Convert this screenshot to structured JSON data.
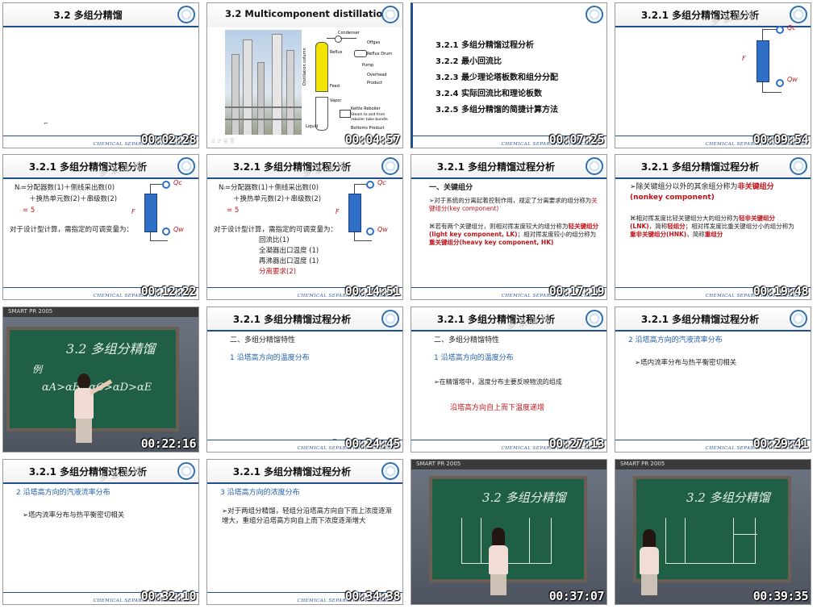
{
  "footer_text": "CHEMICAL SEPARATION PROCESSES",
  "watermark": "多 录 课 程",
  "tiles": [
    {
      "title": "3.2  多组分精馏",
      "time": "00:02:28"
    },
    {
      "title": "3.2  Multicomponent distillation",
      "time": "00:04:57",
      "diagram": {
        "condenser": "Condenser",
        "offgas": "Offgas",
        "reflux_drum": "Reflux Drum",
        "pump": "Pump",
        "overhead": "Overhead Product",
        "reflux": "Reflux",
        "feed": "Feed",
        "vapor": "Vapor",
        "kettle": "Kettle Reboiler",
        "steam": "Steam to and from reboiler tube bundle",
        "liquid": "Liquid",
        "bottoms": "Bottoms Product",
        "column_label": "Distillation column",
        "bottom_caption": "设 计 装 置"
      }
    },
    {
      "title": "",
      "time": "00:07:25",
      "items": [
        "3.2.1 多组分精馏过程分析",
        "3.2.2 最小回流比",
        "3.2.3 最少理论塔板数和组分分配",
        "3.2.4 实际回流比和理论板数",
        "3.2.5 多组分精馏的简捷计算方法"
      ]
    },
    {
      "title": "3.2.1 多组分精馏过程分析",
      "time": "00:09:54",
      "labels": {
        "qc": "Qc",
        "qw": "Qw",
        "f": "F"
      }
    },
    {
      "title": "3.2.1 多组分精馏过程分析",
      "time": "00:12:22",
      "lines": [
        "Nᵢ=分配器数(1)＋侧线采出数(0)",
        "＋换热单元数(2)＋串级数(2)",
        "= 5",
        "对于设计型计算，需指定的可调变量为："
      ],
      "labels": {
        "qc": "Qc",
        "qw": "Qw",
        "f": "F"
      }
    },
    {
      "title": "3.2.1 多组分精馏过程分析",
      "time": "00:14:51",
      "lines": [
        "Nᵢ=分配器数(1)＋侧线采出数(0)",
        "＋换热单元数(2)＋串级数(2)",
        "= 5",
        "对于设计型计算，需指定的可调变量为："
      ],
      "list": [
        "回流比(1)",
        "全凝器出口温度 (1)",
        "再沸器出口温度 (1)",
        "分离要求(2)"
      ],
      "labels": {
        "qc": "Qc",
        "qw": "Qw",
        "f": "F"
      }
    },
    {
      "title": "3.2.1 多组分精馏过程分析",
      "time": "00:17:19",
      "heading": "一、关键组分",
      "p1a": "对于系统的分离起着控制作用，规定了分离要求的组分称为",
      "p1b": "关键组分(key component)",
      "p2a": "若有两个关键组分，则相对挥发度较大的组分称为",
      "p2b": "轻关键组分(light key component, LK)",
      "p2c": "；相对挥发度较小的组分称为",
      "p2d": "重关键组分(heavy key component, HK)"
    },
    {
      "title": "3.2.1 多组分精馏过程分析",
      "time": "00:19:48",
      "p1a": "除关键组分以外的其余组分称为",
      "p1b": "非关键组分(nonkey component)",
      "p2a": "相对挥发度比轻关键组分大的组分称为",
      "p2b": "轻非关键组分(LNK)",
      "p2c": "，简称",
      "p2d": "轻组分",
      "p2e": "；相对挥发度比重关键组分小的组分称为",
      "p2f": "重非关键组分(HNK)",
      "p2g": "，简称",
      "p2h": "重组分"
    },
    {
      "bar": "SMART  PR 2005",
      "time": "00:22:16",
      "chalk1": "3.2 多组分精馏",
      "chalk2": "例",
      "chalk3": "αA>αB>αC>αD>αE"
    },
    {
      "title": "3.2.1 多组分精馏过程分析",
      "time": "00:24:45",
      "heading": "二、多组分精馏特性",
      "sub": "1  沿塔高方向的温度分布"
    },
    {
      "title": "3.2.1 多组分精馏过程分析",
      "time": "00:27:13",
      "heading": "二、多组分精馏特性",
      "sub": "1  沿塔高方向的温度分布",
      "bullet": "在精馏塔中，温度分布主要反映物流的组成",
      "emph": "沿塔高方向自上而下温度递增"
    },
    {
      "title": "3.2.1 多组分精馏过程分析",
      "time": "00:29:41",
      "sub": "2  沿塔高方向的汽液流率分布",
      "bullet": "塔内流率分布与热平衡密切相关"
    },
    {
      "title": "3.2.1 多组分精馏过程分析",
      "time": "00:32:10",
      "sub": "2  沿塔高方向的汽液流率分布",
      "bullet": "塔内流率分布与热平衡密切相关"
    },
    {
      "title": "3.2.1 多组分精馏过程分析",
      "time": "00:34:38",
      "sub": "3  沿塔高方向的浓度分布",
      "bullet": "对于两组分精馏，轻组分沿塔高方向自下而上浓度逐渐增大，重组分沿塔高方向自上而下浓度逐渐增大"
    },
    {
      "bar": "SMART  PR 2005",
      "time": "00:37:07",
      "chalk1": "3.2 多组分精馏"
    },
    {
      "bar": "SMART  PR 2005",
      "time": "00:39:35",
      "chalk1": "3.2 多组分精馏"
    }
  ]
}
